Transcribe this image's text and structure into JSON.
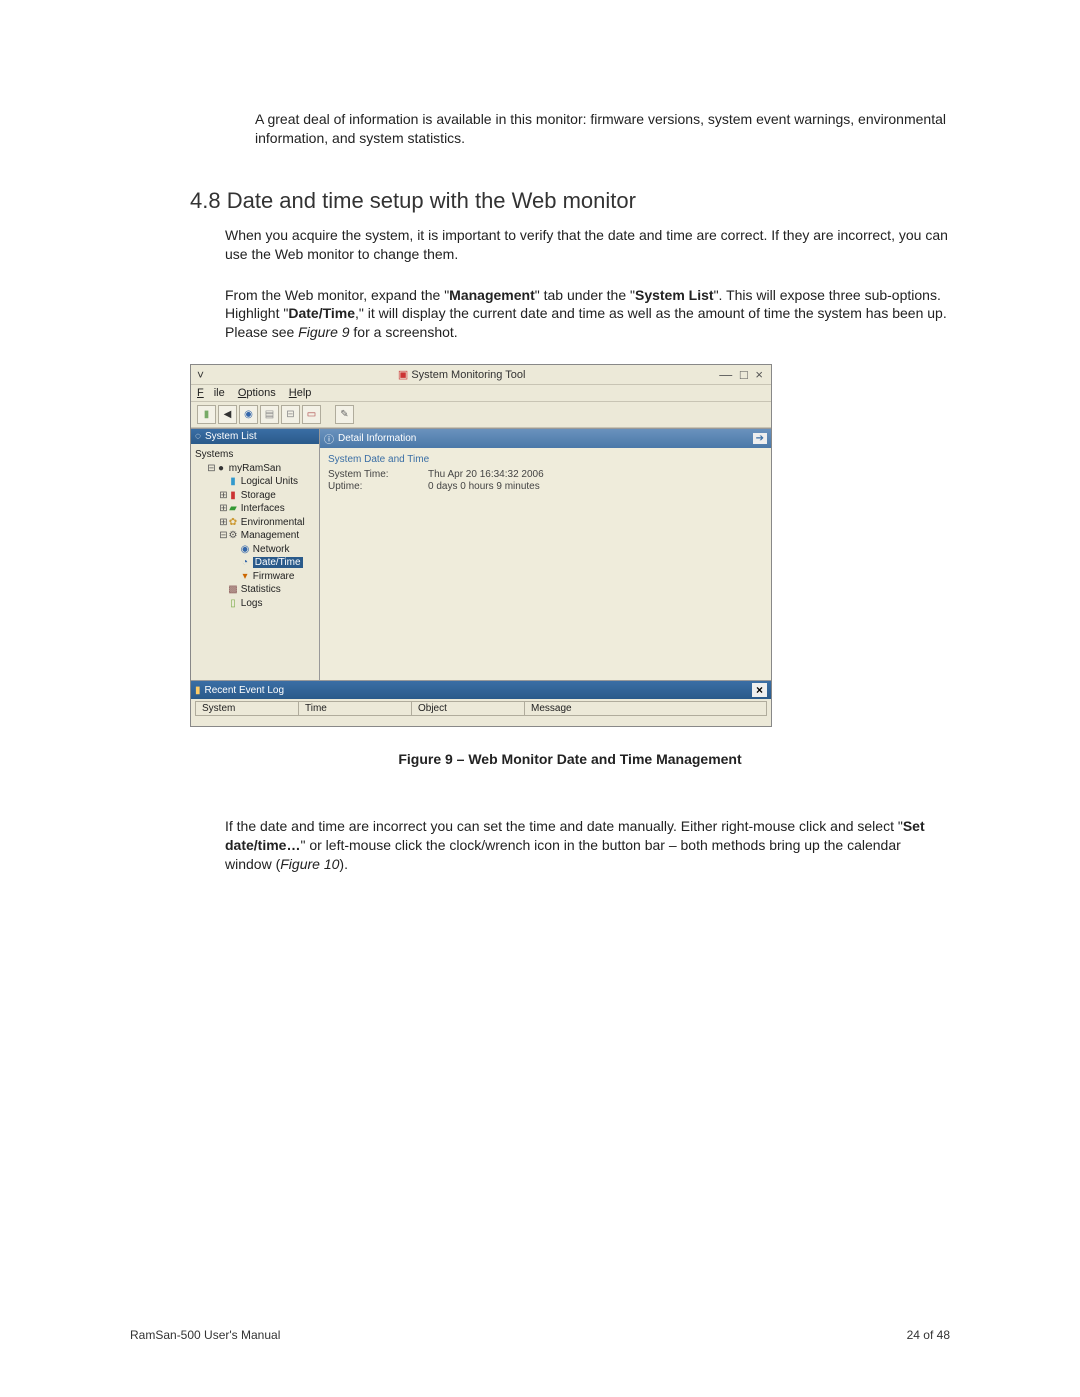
{
  "intro": "A great deal of information is available in this monitor: firmware versions, system event warnings, environmental information, and system statistics.",
  "section_number": "4.8",
  "section_title": "Date and time setup with the Web monitor",
  "para1_a": "When you acquire the system, it is important to verify that the date and time are correct.  If they are incorrect, you can use the Web monitor to change them.",
  "para2_pre": "From the Web monitor, expand the \"",
  "para2_mgmt": "Management",
  "para2_mid1": "\" tab under the \"",
  "para2_syslist": "System List",
  "para2_mid2": "\".  This will expose three sub-options.  Highlight \"",
  "para2_dt": "Date/Time",
  "para2_mid3": ",\" it will display the current date and time as well as the amount of time the system has been up.  Please see ",
  "para2_figref": "Figure 9",
  "para2_end": " for a screenshot.",
  "screenshot": {
    "title": "System Monitoring Tool",
    "menu": {
      "file": "File",
      "options": "Options",
      "help": "Help"
    },
    "left_header": "System List",
    "tree": {
      "systems": "Systems",
      "myramsan": "myRamSan",
      "logical_units": "Logical Units",
      "storage": "Storage",
      "interfaces": "Interfaces",
      "environmental": "Environmental",
      "management": "Management",
      "network": "Network",
      "datetime": "Date/Time",
      "firmware": "Firmware",
      "statistics": "Statistics",
      "logs": "Logs"
    },
    "detail_header": "Detail Information",
    "detail_title": "System Date and Time",
    "systime_label": "System Time:",
    "systime_value": "Thu Apr 20 16:34:32 2006",
    "uptime_label": "Uptime:",
    "uptime_value": "0 days  0 hours  9 minutes",
    "arrow": "➔",
    "eventlog_header": "Recent Event Log",
    "cols": {
      "system": "System",
      "time": "Time",
      "object": "Object",
      "message": "Message"
    },
    "winbtn_min": "—",
    "winbtn_max": "□",
    "winbtn_close": "×",
    "close_x": "×",
    "chevron": "˅"
  },
  "caption": "Figure 9 – Web Monitor Date and Time Management",
  "para3_a": "If the date and time are incorrect you can set the time and date manually. Either right-mouse click and select \"",
  "para3_bold": "Set date/time…",
  "para3_b": "\" or left-mouse click the clock/wrench icon in the button bar – both methods bring up the calendar window (",
  "para3_figref": "Figure 10",
  "para3_c": ").",
  "footer_left": "RamSan-500 User's Manual",
  "footer_right": "24 of 48"
}
